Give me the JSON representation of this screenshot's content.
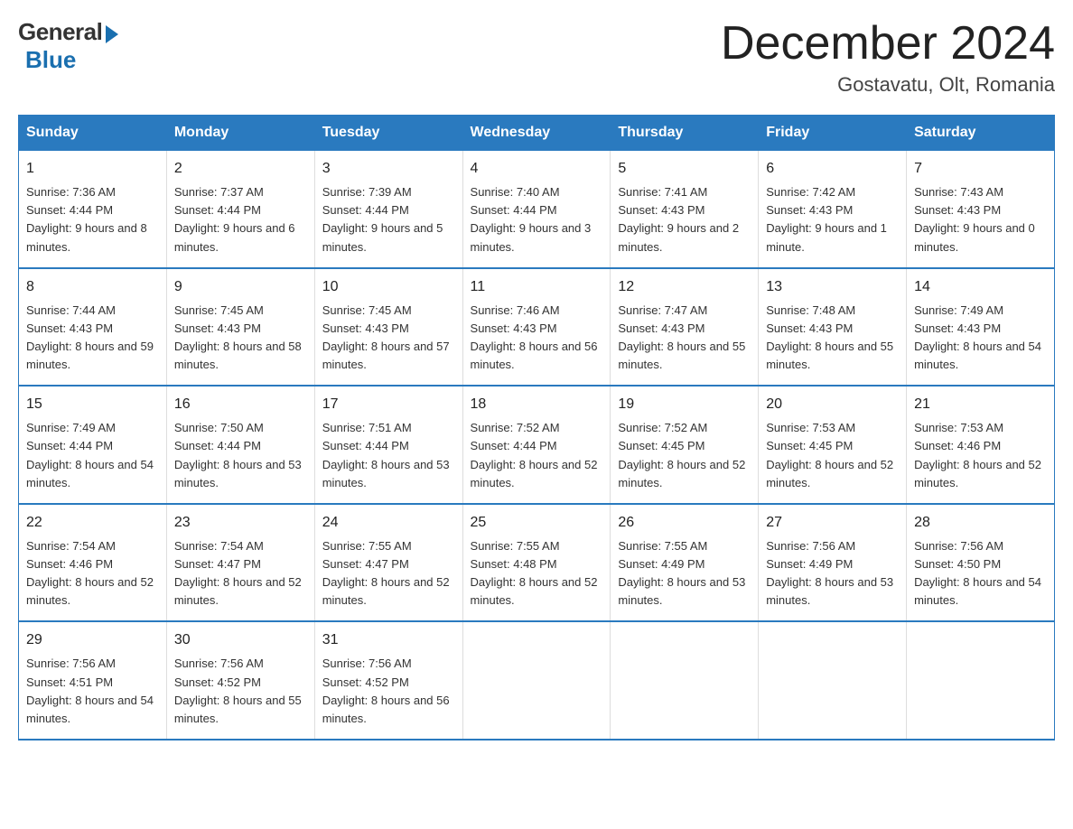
{
  "header": {
    "logo_general": "General",
    "logo_blue": "Blue",
    "month_title": "December 2024",
    "location": "Gostavatu, Olt, Romania"
  },
  "days_of_week": [
    "Sunday",
    "Monday",
    "Tuesday",
    "Wednesday",
    "Thursday",
    "Friday",
    "Saturday"
  ],
  "weeks": [
    [
      {
        "day": "1",
        "sunrise": "7:36 AM",
        "sunset": "4:44 PM",
        "daylight": "9 hours and 8 minutes."
      },
      {
        "day": "2",
        "sunrise": "7:37 AM",
        "sunset": "4:44 PM",
        "daylight": "9 hours and 6 minutes."
      },
      {
        "day": "3",
        "sunrise": "7:39 AM",
        "sunset": "4:44 PM",
        "daylight": "9 hours and 5 minutes."
      },
      {
        "day": "4",
        "sunrise": "7:40 AM",
        "sunset": "4:44 PM",
        "daylight": "9 hours and 3 minutes."
      },
      {
        "day": "5",
        "sunrise": "7:41 AM",
        "sunset": "4:43 PM",
        "daylight": "9 hours and 2 minutes."
      },
      {
        "day": "6",
        "sunrise": "7:42 AM",
        "sunset": "4:43 PM",
        "daylight": "9 hours and 1 minute."
      },
      {
        "day": "7",
        "sunrise": "7:43 AM",
        "sunset": "4:43 PM",
        "daylight": "9 hours and 0 minutes."
      }
    ],
    [
      {
        "day": "8",
        "sunrise": "7:44 AM",
        "sunset": "4:43 PM",
        "daylight": "8 hours and 59 minutes."
      },
      {
        "day": "9",
        "sunrise": "7:45 AM",
        "sunset": "4:43 PM",
        "daylight": "8 hours and 58 minutes."
      },
      {
        "day": "10",
        "sunrise": "7:45 AM",
        "sunset": "4:43 PM",
        "daylight": "8 hours and 57 minutes."
      },
      {
        "day": "11",
        "sunrise": "7:46 AM",
        "sunset": "4:43 PM",
        "daylight": "8 hours and 56 minutes."
      },
      {
        "day": "12",
        "sunrise": "7:47 AM",
        "sunset": "4:43 PM",
        "daylight": "8 hours and 55 minutes."
      },
      {
        "day": "13",
        "sunrise": "7:48 AM",
        "sunset": "4:43 PM",
        "daylight": "8 hours and 55 minutes."
      },
      {
        "day": "14",
        "sunrise": "7:49 AM",
        "sunset": "4:43 PM",
        "daylight": "8 hours and 54 minutes."
      }
    ],
    [
      {
        "day": "15",
        "sunrise": "7:49 AM",
        "sunset": "4:44 PM",
        "daylight": "8 hours and 54 minutes."
      },
      {
        "day": "16",
        "sunrise": "7:50 AM",
        "sunset": "4:44 PM",
        "daylight": "8 hours and 53 minutes."
      },
      {
        "day": "17",
        "sunrise": "7:51 AM",
        "sunset": "4:44 PM",
        "daylight": "8 hours and 53 minutes."
      },
      {
        "day": "18",
        "sunrise": "7:52 AM",
        "sunset": "4:44 PM",
        "daylight": "8 hours and 52 minutes."
      },
      {
        "day": "19",
        "sunrise": "7:52 AM",
        "sunset": "4:45 PM",
        "daylight": "8 hours and 52 minutes."
      },
      {
        "day": "20",
        "sunrise": "7:53 AM",
        "sunset": "4:45 PM",
        "daylight": "8 hours and 52 minutes."
      },
      {
        "day": "21",
        "sunrise": "7:53 AM",
        "sunset": "4:46 PM",
        "daylight": "8 hours and 52 minutes."
      }
    ],
    [
      {
        "day": "22",
        "sunrise": "7:54 AM",
        "sunset": "4:46 PM",
        "daylight": "8 hours and 52 minutes."
      },
      {
        "day": "23",
        "sunrise": "7:54 AM",
        "sunset": "4:47 PM",
        "daylight": "8 hours and 52 minutes."
      },
      {
        "day": "24",
        "sunrise": "7:55 AM",
        "sunset": "4:47 PM",
        "daylight": "8 hours and 52 minutes."
      },
      {
        "day": "25",
        "sunrise": "7:55 AM",
        "sunset": "4:48 PM",
        "daylight": "8 hours and 52 minutes."
      },
      {
        "day": "26",
        "sunrise": "7:55 AM",
        "sunset": "4:49 PM",
        "daylight": "8 hours and 53 minutes."
      },
      {
        "day": "27",
        "sunrise": "7:56 AM",
        "sunset": "4:49 PM",
        "daylight": "8 hours and 53 minutes."
      },
      {
        "day": "28",
        "sunrise": "7:56 AM",
        "sunset": "4:50 PM",
        "daylight": "8 hours and 54 minutes."
      }
    ],
    [
      {
        "day": "29",
        "sunrise": "7:56 AM",
        "sunset": "4:51 PM",
        "daylight": "8 hours and 54 minutes."
      },
      {
        "day": "30",
        "sunrise": "7:56 AM",
        "sunset": "4:52 PM",
        "daylight": "8 hours and 55 minutes."
      },
      {
        "day": "31",
        "sunrise": "7:56 AM",
        "sunset": "4:52 PM",
        "daylight": "8 hours and 56 minutes."
      },
      null,
      null,
      null,
      null
    ]
  ],
  "labels": {
    "sunrise": "Sunrise:",
    "sunset": "Sunset:",
    "daylight": "Daylight:"
  }
}
